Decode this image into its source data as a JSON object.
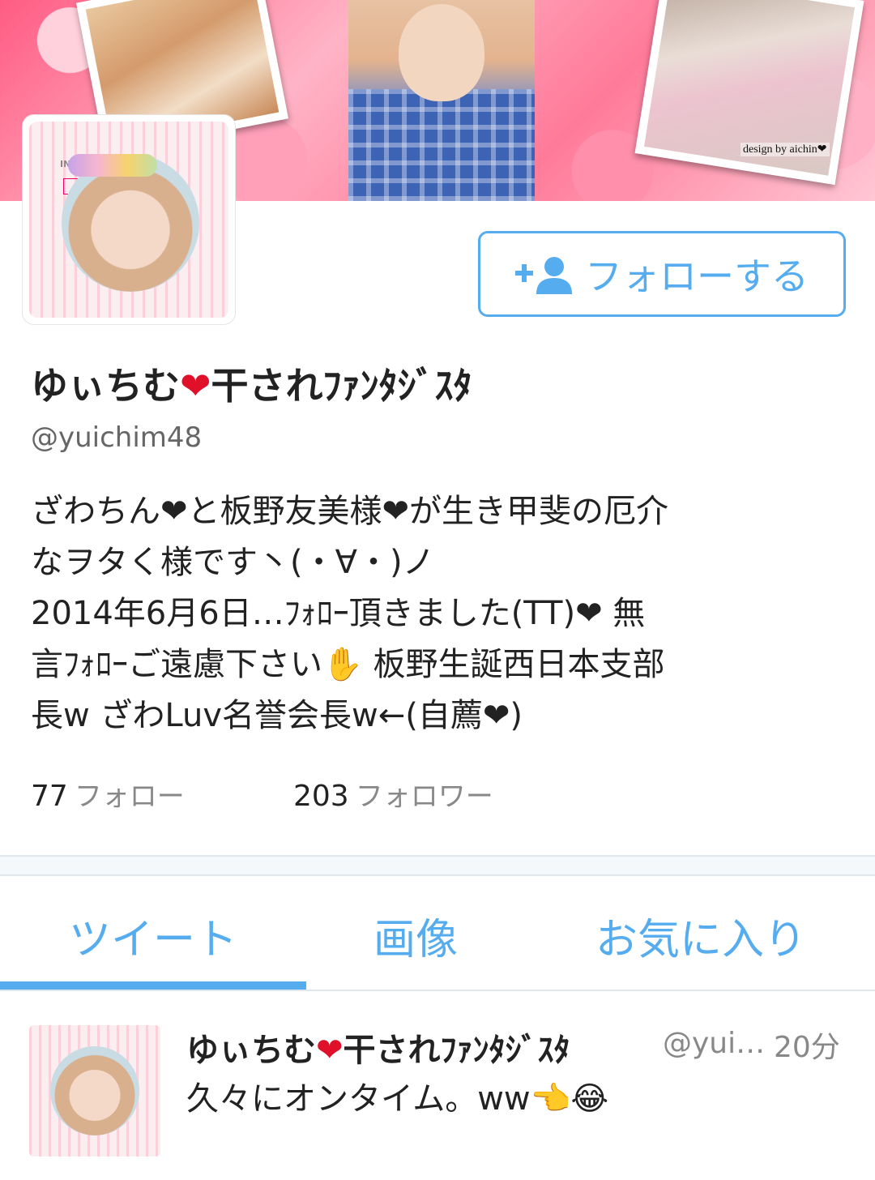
{
  "banner": {
    "design_credit": "design by  aichin❤"
  },
  "profile": {
    "follow_button_label": "フォローする",
    "display_name": "ゆぃちむ",
    "display_name_heart": "❤",
    "display_name_suffix": "干されﾌｧﾝﾀｼﾞｽﾀ",
    "handle": "@yuichim48",
    "bio_lines": [
      "ざわちん❤と板野友美様❤が生き甲斐の厄介",
      "なヲタく様です丶(・∀・)ノ",
      "2014年6月6日…ﾌｫﾛｰ頂きました(TT)❤  無",
      "言ﾌｫﾛｰご遠慮下さい✋ 板野生誕西日本支部",
      "長w  ざわLuv名誉会長w←(自薦❤)"
    ],
    "following_count": "77",
    "following_label": "フォロー",
    "followers_count": "203",
    "followers_label": "フォロワー"
  },
  "tabs": {
    "tweets": "ツイート",
    "media": "画像",
    "likes": "お気に入り"
  },
  "tweet": {
    "name": "ゆぃちむ",
    "name_heart": "❤",
    "name_suffix": "干されﾌｧﾝﾀｼﾞｽﾀ",
    "handle": "@yui…",
    "time": "20分",
    "text": "久々にオンタイム。ww👈😂"
  },
  "colors": {
    "accent": "#55acee",
    "heart": "#e0102a"
  }
}
